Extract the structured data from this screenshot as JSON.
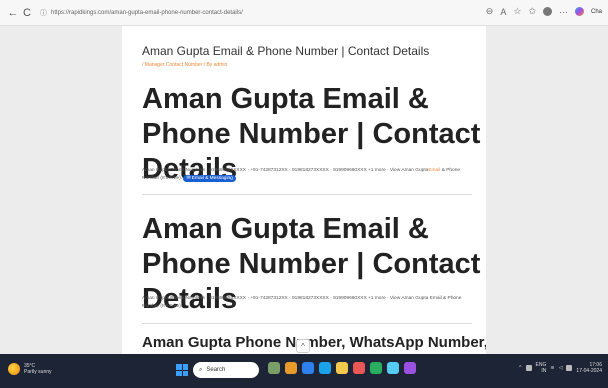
{
  "browser": {
    "back": "←",
    "refresh": "C",
    "lock": "ⓘ",
    "url": "https://rapidkings.com/aman-gupta-email-phone-number-contact-details/",
    "cht": "Cha"
  },
  "page": {
    "site_title": "Aman Gupta Email & Phone Number | Contact Details",
    "meta": "/ Manager Contact Number / By admin",
    "h1": "Aman Gupta Email & Phone Number | Contact Details",
    "snippet1": "Aman Gupta Phone Numbers · 919686655XXXX · +91-74287312XX · 919818273XXXX · 919909660XXX +1 more · View Aman Gupta",
    "snippet1_hl": "Email",
    "snippet1_tail": " & Phone Number (It's Free). ",
    "badge": "✉ Email & Messaging",
    "h1_repeat": "Aman Gupta Email & Phone Number | Contact Details",
    "snippet2": "Aman Gupta Phone Numbers · 919686655XXXX · +91-74287312XX · 919818273XXXX · 919909660XXX +1 more · View Aman Gupta Email & Phone Number (It's Free).",
    "h2": "Aman Gupta Phone Number, WhatsApp Number,",
    "scroll_top": "^"
  },
  "taskbar": {
    "temp": "35°C",
    "weather": "Partly sunny",
    "search": "Search",
    "lang": "ENG",
    "region": "IN",
    "time": "17:06",
    "date": "17-04-2024"
  }
}
